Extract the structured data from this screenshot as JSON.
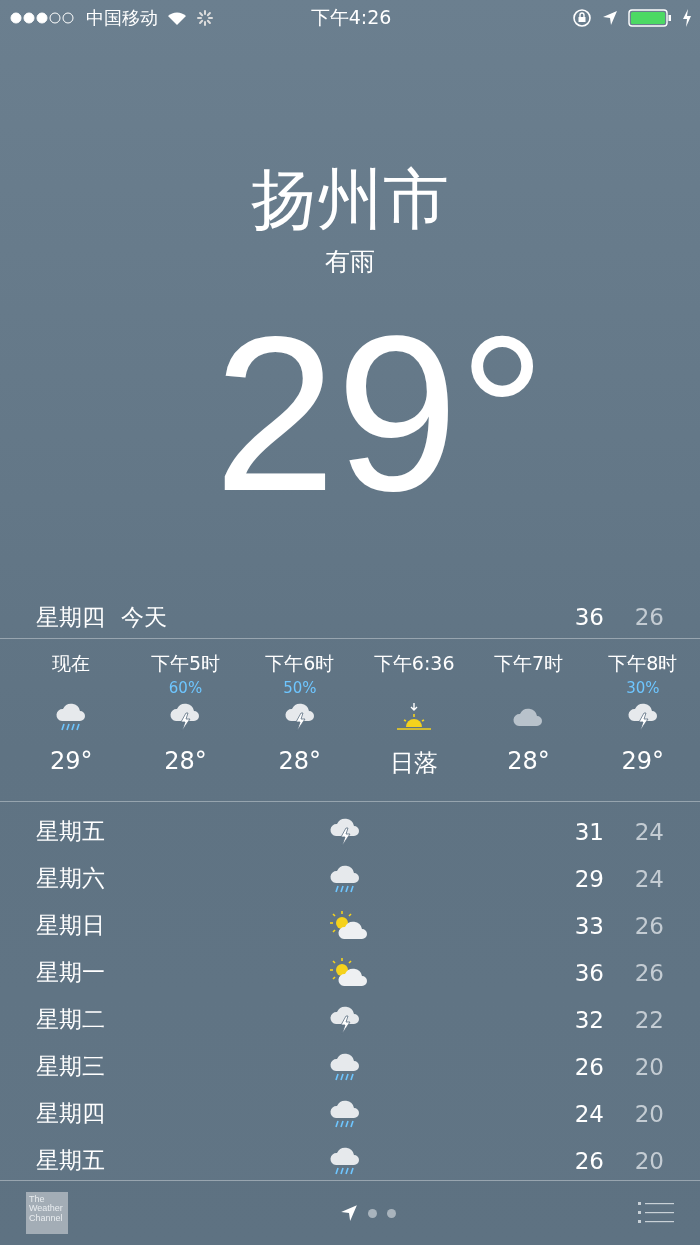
{
  "status_bar": {
    "carrier": "中国移动",
    "time": "下午4:26"
  },
  "location": {
    "city": "扬州市",
    "condition": "有雨",
    "temperature": "29°"
  },
  "today": {
    "day": "星期四",
    "label": "今天",
    "high": "36",
    "low": "26"
  },
  "hourly": [
    {
      "time": "现在",
      "kind": "rain",
      "temp": "29°"
    },
    {
      "time": "下午5时",
      "precip": "60%",
      "kind": "thunder",
      "temp": "28°"
    },
    {
      "time": "下午6时",
      "precip": "50%",
      "kind": "thunder",
      "temp": "28°"
    },
    {
      "time": "下午6:36",
      "kind": "sunset",
      "temp": "日落"
    },
    {
      "time": "下午7时",
      "kind": "cloud",
      "temp": "28°"
    },
    {
      "time": "下午8时",
      "precip": "30%",
      "kind": "thunder",
      "temp": "29°"
    }
  ],
  "daily": [
    {
      "day": "星期五",
      "kind": "thunder",
      "high": "31",
      "low": "24"
    },
    {
      "day": "星期六",
      "kind": "rain",
      "high": "29",
      "low": "24"
    },
    {
      "day": "星期日",
      "kind": "partly-sunny",
      "high": "33",
      "low": "26"
    },
    {
      "day": "星期一",
      "kind": "partly-sunny",
      "high": "36",
      "low": "26"
    },
    {
      "day": "星期二",
      "kind": "thunder",
      "high": "32",
      "low": "22"
    },
    {
      "day": "星期三",
      "kind": "rain",
      "high": "26",
      "low": "20"
    },
    {
      "day": "星期四",
      "kind": "rain",
      "high": "24",
      "low": "20"
    },
    {
      "day": "星期五",
      "kind": "rain",
      "high": "26",
      "low": "20"
    }
  ],
  "bottom_bar": {
    "logo": "The Weather Channel",
    "pages": [
      {
        "kind": "location",
        "selected": true
      },
      {
        "kind": "dot",
        "selected": false
      },
      {
        "kind": "dot",
        "selected": false
      }
    ]
  }
}
